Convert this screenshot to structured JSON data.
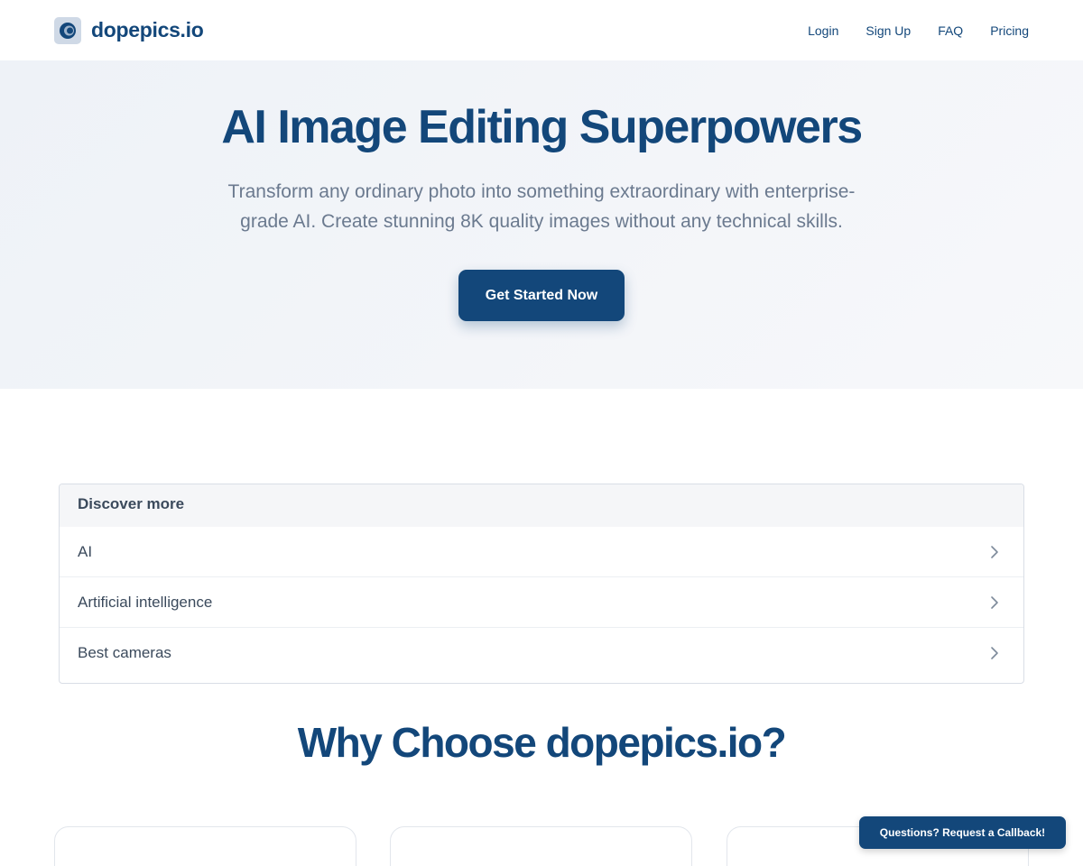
{
  "header": {
    "brand_name": "dopepics.io",
    "logo_icon": "camera-lens-icon",
    "nav": [
      {
        "label": "Login"
      },
      {
        "label": "Sign Up"
      },
      {
        "label": "FAQ"
      },
      {
        "label": "Pricing"
      }
    ]
  },
  "hero": {
    "title": "AI Image Editing Superpowers",
    "subtitle": "Transform any ordinary photo into something extraordinary with enterprise-grade AI. Create stunning 8K quality images without any technical skills.",
    "cta_label": "Get Started Now"
  },
  "discover": {
    "heading": "Discover more",
    "items": [
      {
        "label": "AI",
        "icon": "chevron-right-icon"
      },
      {
        "label": "Artificial intelligence",
        "icon": "chevron-right-icon"
      },
      {
        "label": "Best cameras",
        "icon": "chevron-right-icon"
      }
    ]
  },
  "why": {
    "title": "Why Choose dopepics.io?"
  },
  "callback": {
    "label": "Questions? Request a Callback!"
  },
  "colors": {
    "brand": "#13477a",
    "hero_background": "#eef2f7",
    "subtitle_text": "#6b7a8f"
  }
}
